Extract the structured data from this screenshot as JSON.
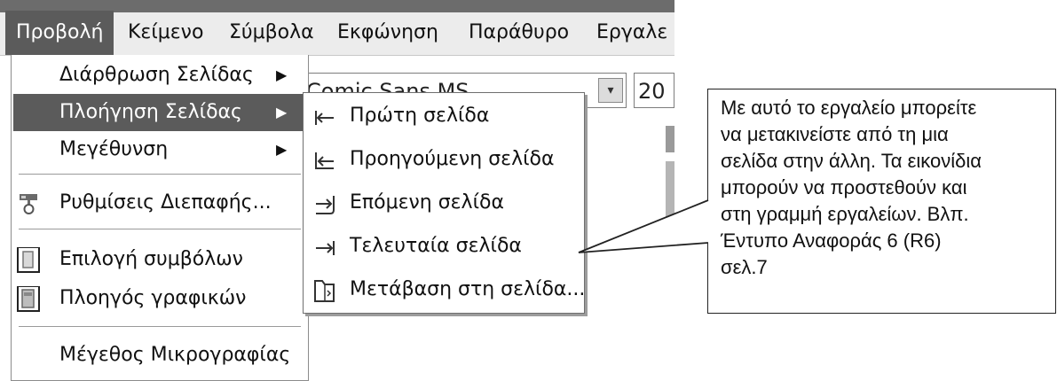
{
  "menubar": {
    "items": [
      {
        "label": "Προβολή",
        "active": true
      },
      {
        "label": "Κείμενο"
      },
      {
        "label": "Σύμβολα"
      },
      {
        "label": "Εκφώνηση"
      },
      {
        "label": "Παράθυρο"
      },
      {
        "label": "Εργαλε"
      }
    ]
  },
  "toolbar": {
    "font_value": "Comic Sans MS",
    "font_dropdown_glyph": "▾",
    "size_value": "20"
  },
  "view_menu": {
    "items": [
      {
        "label": "Διάρθρωση Σελίδας",
        "arrow": "▶"
      },
      {
        "label": "Πλοήγηση Σελίδας",
        "arrow": "▶"
      },
      {
        "label": "Μεγέθυνση",
        "arrow": "▶"
      },
      {
        "label": "Ρυθμίσεις Διεπαφής..."
      },
      {
        "label": "Επιλογή συμβόλων"
      },
      {
        "label": "Πλοηγός γραφικών"
      },
      {
        "label": "Μέγεθος Μικρογραφίας"
      }
    ]
  },
  "navigation_submenu": {
    "items": [
      {
        "label": "Πρώτη σελίδα",
        "icon": "first-page-icon"
      },
      {
        "label": "Προηγούμενη σελίδα",
        "icon": "previous-page-icon"
      },
      {
        "label": "Επόμενη σελίδα",
        "icon": "next-page-icon"
      },
      {
        "label": "Τελευταία σελίδα",
        "icon": "last-page-icon"
      },
      {
        "label": "Μετάβαση στη σελίδα...",
        "icon": "goto-page-icon"
      }
    ]
  },
  "callout": {
    "lines": [
      "Με αυτό το εργαλείο μπορείτε",
      "να μετακινείστε από τη μια",
      "σελίδα στην άλλη. Τα εικονίδια",
      "μπορούν να προστεθούν και",
      "στη γραμμή εργαλείων. Βλπ.",
      "Έντυπο Αναφοράς 6 (R6)",
      "σελ.7"
    ]
  },
  "colors": {
    "highlight": "#5b5b5b",
    "menu_bg": "#ffffff",
    "menubar_bg": "#ececec"
  }
}
